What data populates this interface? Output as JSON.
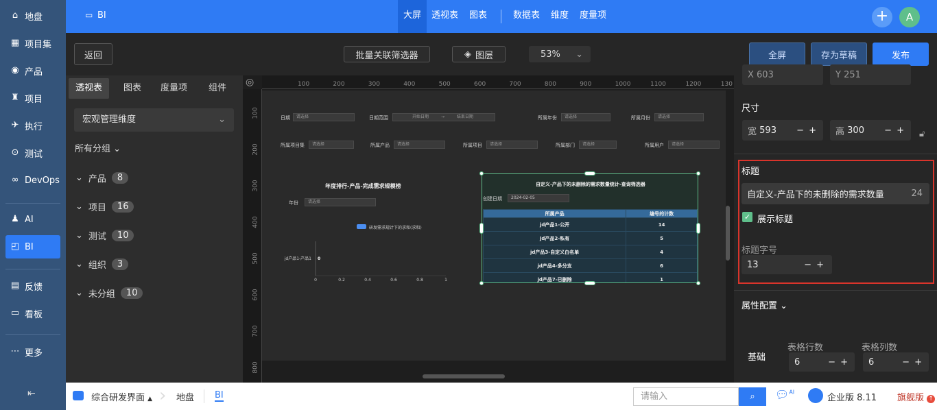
{
  "nav": {
    "items": [
      {
        "icon": "⌂",
        "label": "地盘",
        "name": "home"
      },
      {
        "icon": "▦",
        "label": "项目集",
        "name": "program"
      },
      {
        "icon": "◉",
        "label": "产品",
        "name": "product"
      },
      {
        "icon": "♜",
        "label": "项目",
        "name": "project"
      },
      {
        "icon": "✈",
        "label": "执行",
        "name": "execution"
      },
      {
        "icon": "⊙",
        "label": "测试",
        "name": "qa"
      },
      {
        "icon": "∞",
        "label": "DevOps",
        "name": "devops"
      },
      {
        "icon": "♟",
        "label": "AI",
        "name": "ai"
      },
      {
        "icon": "◰",
        "label": "BI",
        "name": "bi"
      },
      {
        "icon": "▤",
        "label": "反馈",
        "name": "feedback"
      },
      {
        "icon": "▭",
        "label": "看板",
        "name": "kanban"
      },
      {
        "icon": "⋯",
        "label": "更多",
        "name": "more"
      }
    ],
    "collapse_icon": "⇤"
  },
  "topbar": {
    "app": "BI",
    "tabs": [
      "大屏",
      "透视表",
      "图表"
    ],
    "tabs2": [
      "数据表",
      "维度",
      "度量项"
    ],
    "avatar": "A",
    "plus": "+"
  },
  "toolbar": {
    "back": "返回",
    "batch": "批量关联筛选器",
    "layers": "图层",
    "zoom": "53%",
    "fullscreen": "全屏",
    "save_draft": "存为草稿",
    "publish": "发布"
  },
  "left": {
    "tabs": [
      "透视表",
      "图表",
      "度量项",
      "组件"
    ],
    "dimension": "宏观管理维度",
    "all_groups": "所有分组",
    "groups": [
      {
        "label": "产品",
        "count": "8"
      },
      {
        "label": "项目",
        "count": "16"
      },
      {
        "label": "测试",
        "count": "10"
      },
      {
        "label": "组织",
        "count": "3"
      },
      {
        "label": "未分组",
        "count": "10"
      }
    ]
  },
  "canvas": {
    "ruler_h": [
      "100",
      "200",
      "300",
      "400",
      "500",
      "600",
      "700",
      "800",
      "900",
      "1000",
      "1100",
      "1200",
      "130"
    ],
    "ruler_v": [
      "100",
      "200",
      "300",
      "400",
      "500",
      "600",
      "700",
      "800"
    ],
    "filters_row1": [
      {
        "label": "日期",
        "ph": "请选择"
      },
      {
        "label": "日期范围",
        "ph": "开始日期",
        "ph2": "结束日期"
      },
      {
        "label": "所属年份",
        "ph": "请选择"
      },
      {
        "label": "所属月份",
        "ph": "请选择"
      }
    ],
    "filters_row2": [
      {
        "label": "所属项目集",
        "ph": "请选择"
      },
      {
        "label": "所属产品",
        "ph": "请选择"
      },
      {
        "label": "所属项目",
        "ph": "请选择"
      },
      {
        "label": "所属部门",
        "ph": "请选择"
      },
      {
        "label": "所属用户",
        "ph": "请选择"
      }
    ],
    "chart1": {
      "title": "年度排行-产品-完成需求规模榜",
      "filter_label": "年份",
      "filter_ph": "请选择",
      "legend": "研发需求规计下的求和(求和)"
    },
    "table": {
      "title": "自定义-产品下的未删除的需求数量统计-查询筛选器",
      "date_label": "创建日期",
      "date_value": "2024-02-05",
      "headers": [
        "所属产品",
        "编号的计数"
      ],
      "rows": [
        [
          "jd产品1-公开",
          "14"
        ],
        [
          "jd产品2-私有",
          "5"
        ],
        [
          "jd产品3-自定义白名单",
          "4"
        ],
        [
          "jd产品4-多分支",
          "6"
        ],
        [
          "jd产品7-已删除",
          "1"
        ]
      ]
    }
  },
  "chart_data": {
    "type": "bar",
    "title": "年度排行-产品-完成需求规模榜",
    "categories": [
      "jd产品1-产品1"
    ],
    "series": [
      {
        "name": "研发需求规计下的求和(求和)",
        "values": [
          0
        ]
      }
    ],
    "xlim": [
      0,
      1
    ],
    "xticks": [
      "0",
      "0.2",
      "0.4",
      "0.6",
      "0.8",
      "1"
    ],
    "data_labels": [
      "0"
    ]
  },
  "right": {
    "pos_x": "X 603",
    "pos_y": "Y 251",
    "size_label": "尺寸",
    "width_label": "宽",
    "width": "593",
    "height_label": "高",
    "height": "300",
    "title_section": "标题",
    "title_value": "自定义-产品下的未删除的需求数量",
    "title_count": "24",
    "show_title": "展示标题",
    "font_label": "标题字号",
    "font_value": "13",
    "attr_config": "属性配置",
    "basic": "基础",
    "rows_label": "表格行数",
    "rows_value": "6",
    "cols_label": "表格列数",
    "cols_value": "6"
  },
  "bottom": {
    "workspace": "综合研发界面",
    "crumb1": "地盘",
    "crumb2": "BI",
    "search_ph": "请输入",
    "edition": "企业版 8.11",
    "flagship": "旗舰版",
    "ai": "AI"
  }
}
